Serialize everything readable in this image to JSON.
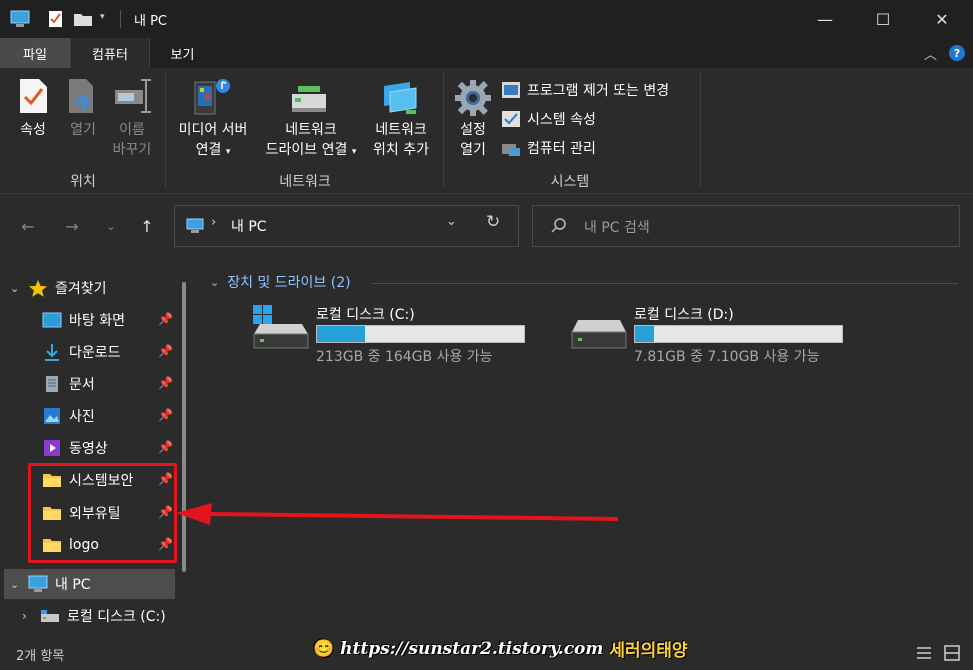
{
  "window": {
    "title": "내 PC",
    "minimize": "—",
    "maximize": "☐",
    "close": "✕"
  },
  "ribbon_tabs": [
    "파일",
    "컴퓨터",
    "보기"
  ],
  "ribbon": {
    "location_group": {
      "label": "위치",
      "properties": "속성",
      "open": "열기",
      "rename_line1": "이름",
      "rename_line2": "바꾸기"
    },
    "network_group": {
      "label": "네트워크",
      "media_line1": "미디어 서버",
      "media_line2": "연결",
      "map_line1": "네트워크",
      "map_line2": "드라이브 연결",
      "add_line1": "네트워크",
      "add_line2": "위치 추가"
    },
    "system_group": {
      "label": "시스템",
      "settings_line1": "설정",
      "settings_line2": "열기",
      "uninstall": "프로그램 제거 또는 변경",
      "sysprops": "시스템 속성",
      "manage": "컴퓨터 관리"
    }
  },
  "address": {
    "path": "내 PC",
    "search_placeholder": "내 PC 검색"
  },
  "sidebar": {
    "quick_access": "즐겨찾기",
    "items": [
      {
        "label": "바탕 화면"
      },
      {
        "label": "다운로드"
      },
      {
        "label": "문서"
      },
      {
        "label": "사진"
      },
      {
        "label": "동영상"
      },
      {
        "label": "시스템보안"
      },
      {
        "label": "외부유틸"
      },
      {
        "label": "logo"
      }
    ],
    "this_pc": "내 PC",
    "local_disk": "로컬 디스크 (C:)"
  },
  "content": {
    "group_header": "장치 및 드라이브 (2)",
    "drives": [
      {
        "name": "로컬 디스크 (C:)",
        "space": "213GB 중 164GB 사용 가능",
        "used_fraction": 0.23
      },
      {
        "name": "로컬 디스크 (D:)",
        "space": "7.81GB 중 7.10GB 사용 가능",
        "used_fraction": 0.09
      }
    ]
  },
  "status": {
    "item_count": "2개 항목"
  },
  "watermark": {
    "url": "https://sunstar2.tistory.com",
    "name": "세러의태양"
  },
  "colors": {
    "accent": "#26a0da",
    "highlight": "#e3141b"
  }
}
